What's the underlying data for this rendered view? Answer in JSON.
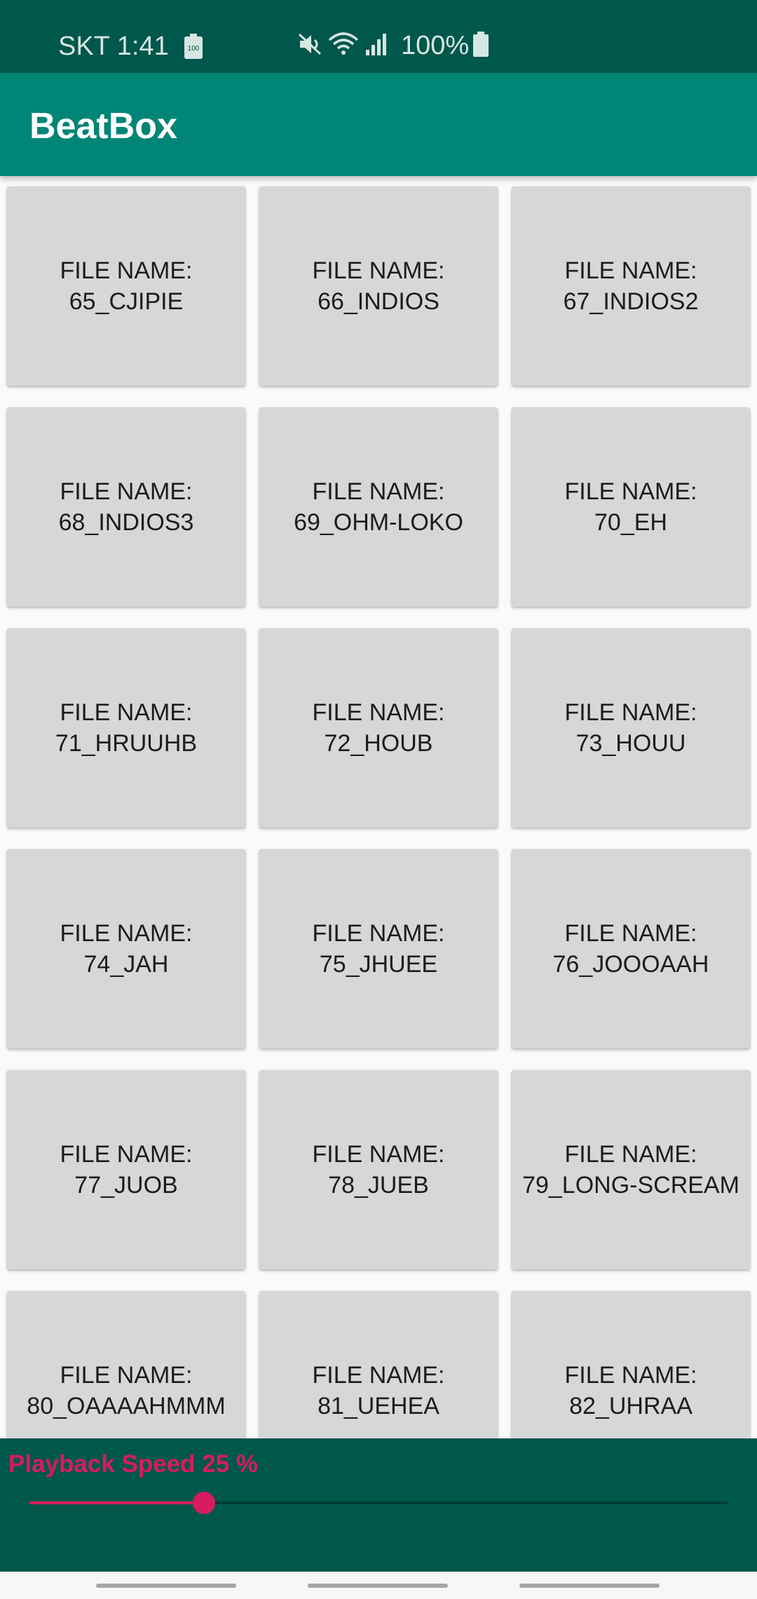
{
  "status_bar": {
    "carrier_time": "SKT 1:41",
    "battery_percent": "100%",
    "battery_saver_text": "100",
    "icons": [
      "battery-saver-icon",
      "mute-icon",
      "wifi-icon",
      "signal-icon",
      "battery-icon"
    ]
  },
  "app_bar": {
    "title": "BeatBox"
  },
  "sounds": [
    {
      "prefix": "FILE NAME:",
      "file": "65_CJIPIE"
    },
    {
      "prefix": "FILE NAME:",
      "file": "66_INDIOS"
    },
    {
      "prefix": "FILE NAME:",
      "file": "67_INDIOS2"
    },
    {
      "prefix": "FILE NAME:",
      "file": "68_INDIOS3"
    },
    {
      "prefix": "FILE NAME:",
      "file": "69_OHM-LOKO"
    },
    {
      "prefix": "FILE NAME:",
      "file": "70_EH"
    },
    {
      "prefix": "FILE NAME:",
      "file": "71_HRUUHB"
    },
    {
      "prefix": "FILE NAME:",
      "file": "72_HOUB"
    },
    {
      "prefix": "FILE NAME:",
      "file": "73_HOUU"
    },
    {
      "prefix": "FILE NAME:",
      "file": "74_JAH"
    },
    {
      "prefix": "FILE NAME:",
      "file": "75_JHUEE"
    },
    {
      "prefix": "FILE NAME:",
      "file": "76_JOOOAAH"
    },
    {
      "prefix": "FILE NAME:",
      "file": "77_JUOB"
    },
    {
      "prefix": "FILE NAME:",
      "file": "78_JUEB"
    },
    {
      "prefix": "FILE NAME:",
      "file": "79_LONG-SCREAM"
    },
    {
      "prefix": "FILE NAME:",
      "file": "80_OAAAAHMMM"
    },
    {
      "prefix": "FILE NAME:",
      "file": "81_UEHEA"
    },
    {
      "prefix": "FILE NAME:",
      "file": "82_UHRAA"
    }
  ],
  "playback": {
    "label": "Playback Speed 25 %",
    "value_fraction": 0.25
  },
  "colors": {
    "status_bar": "#00574b",
    "app_bar": "#008577",
    "accent": "#d81b60",
    "button_bg": "#d6d7d7",
    "background": "#fafafa"
  }
}
